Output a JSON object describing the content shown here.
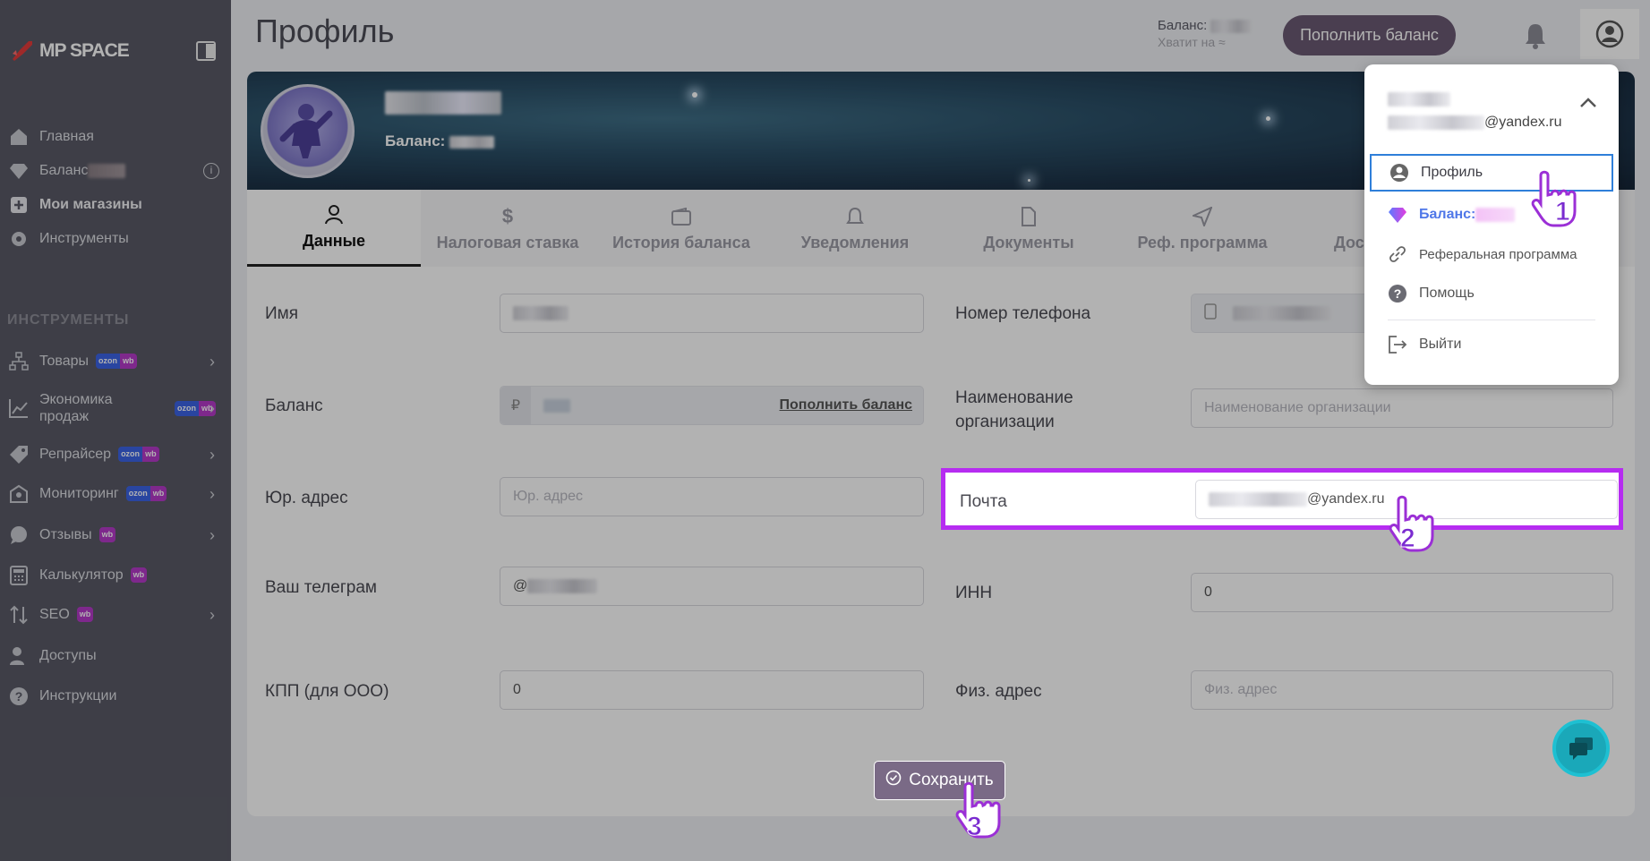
{
  "sidebar": {
    "brand": "MP SPACE",
    "items": [
      {
        "label": "Главная"
      },
      {
        "label": "Баланс"
      },
      {
        "label": "Мои магазины"
      },
      {
        "label": "Инструменты"
      }
    ],
    "section_title": "ИНСТРУМЕНТЫ",
    "tools": [
      {
        "label": "Товары",
        "badge": "ozon wb"
      },
      {
        "label": "Экономика продаж",
        "badge": "ozon wb"
      },
      {
        "label": "Репрайсер",
        "badge": "ozon wb"
      },
      {
        "label": "Мониторинг",
        "badge": "ozon wb"
      },
      {
        "label": "Отзывы",
        "badge": "wb"
      },
      {
        "label": "Калькулятор",
        "badge": "wb"
      },
      {
        "label": "SEO",
        "badge": "wb"
      },
      {
        "label": "Доступы"
      },
      {
        "label": "Инструкции"
      }
    ],
    "badge_ozon": "ozon",
    "badge_wb": "wb"
  },
  "header": {
    "title": "Профиль",
    "balance_label": "Баланс:",
    "balance_sub": "Хватит на ≈",
    "topup_button": "Пополнить баланс"
  },
  "profile": {
    "balance_label": "Баланс:"
  },
  "tabs": [
    {
      "label": "Данные",
      "active": true
    },
    {
      "label": "Налоговая ставка"
    },
    {
      "label": "История баланса"
    },
    {
      "label": "Уведомления"
    },
    {
      "label": "Документы"
    },
    {
      "label": "Реф. программа"
    },
    {
      "label": "Дос"
    }
  ],
  "form": {
    "name_label": "Имя",
    "balance_label": "Баланс",
    "balance_currency": "₽",
    "balance_topup_link": "Пополнить баланс",
    "legal_address_label": "Юр. адрес",
    "legal_address_placeholder": "Юр. адрес",
    "telegram_label": "Ваш телеграм",
    "telegram_prefix": "@",
    "kpp_label": "КПП (для ООО)",
    "kpp_value": "0",
    "phone_label": "Номер телефона",
    "org_label": "Наименование организации",
    "org_placeholder": "Наименование организации",
    "email_label": "Почта",
    "email_suffix": "@yandex.ru",
    "inn_label": "ИНН",
    "inn_value": "0",
    "phys_address_label": "Физ. адрес",
    "phys_address_placeholder": "Физ. адрес",
    "save_button": "Сохранить"
  },
  "dropdown": {
    "email_suffix": "@yandex.ru",
    "items": [
      {
        "label": "Профиль"
      },
      {
        "label": "Баланс:"
      },
      {
        "label": "Реферальная программа"
      },
      {
        "label": "Помощь"
      },
      {
        "label": "Выйти"
      }
    ]
  },
  "annotations": {
    "step1": "1",
    "step2": "2",
    "step3": "3"
  },
  "colors": {
    "highlight": "#b62cf1",
    "primary_button": "#6b5a73",
    "selected_outline": "#2f7fd9",
    "chat": "#1aa8b9"
  }
}
